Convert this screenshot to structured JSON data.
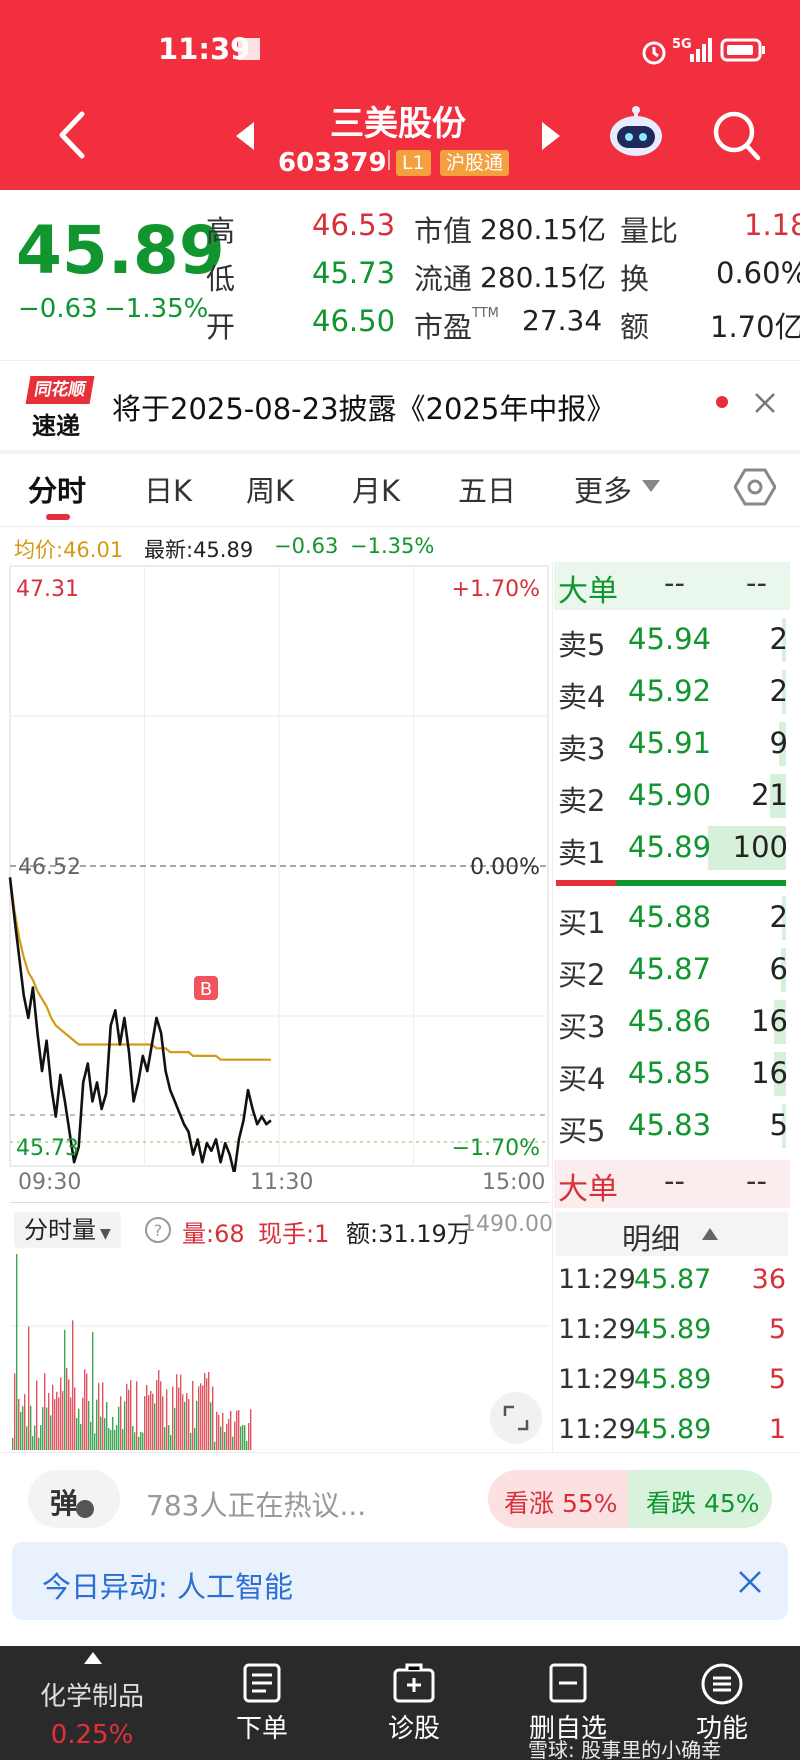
{
  "status_bar": {
    "time": "11:39",
    "network": "5G"
  },
  "header": {
    "title": "三美股份",
    "code": "603379",
    "tag_level": "L1",
    "tag_connect": "沪股通"
  },
  "quote": {
    "price": "45.89",
    "change": "−0.63",
    "change_pct": "−1.35%",
    "high_label": "高",
    "high": "46.53",
    "low_label": "低",
    "low": "45.73",
    "open_label": "开",
    "open": "46.50",
    "mcap_label": "市值",
    "mcap": "280.15亿",
    "float_label": "流通",
    "float": "280.15亿",
    "pe_label": "市盈",
    "pe_sup": "TTM",
    "pe": "27.34",
    "vr_label": "量比",
    "vr": "1.18",
    "turn_label": "换",
    "turn": "0.60%",
    "amt_label": "额",
    "amt": "1.70亿"
  },
  "notice": {
    "logo_top": "同花顺",
    "logo_bottom": "速递",
    "text": "将于2025-08-23披露《2025年中报》"
  },
  "tabs": [
    {
      "label": "分时"
    },
    {
      "label": "日K"
    },
    {
      "label": "周K"
    },
    {
      "label": "月K"
    },
    {
      "label": "五日"
    },
    {
      "label": "更多"
    }
  ],
  "chart_info": {
    "avg": "均价:46.01",
    "latest": "最新:45.89",
    "chg": "−0.63",
    "chg_pct": "−1.35%"
  },
  "chart_data": {
    "type": "line",
    "y_max_label": "47.31",
    "y_mid_label": "46.52",
    "y_min_label": "45.73",
    "pct_max_label": "+1.70%",
    "pct_mid_label": "0.00%",
    "pct_min_label": "−1.70%",
    "x_labels": [
      "09:30",
      "11:30",
      "15:00"
    ],
    "ylim": [
      45.73,
      47.31
    ],
    "prev_close": 46.52,
    "marker_label": "B",
    "price": [
      46.49,
      46.38,
      46.28,
      46.18,
      46.12,
      46.2,
      46.08,
      45.98,
      46.06,
      45.94,
      45.86,
      45.97,
      45.9,
      45.82,
      45.74,
      45.78,
      45.95,
      46.0,
      45.9,
      45.95,
      45.88,
      45.92,
      46.1,
      46.14,
      46.05,
      46.12,
      46.03,
      45.9,
      45.95,
      46.02,
      45.98,
      46.05,
      46.12,
      46.08,
      45.98,
      45.93,
      45.9,
      45.87,
      45.84,
      45.82,
      45.76,
      45.8,
      45.74,
      45.79,
      45.77,
      45.8,
      45.74,
      45.79,
      45.76,
      45.71,
      45.8,
      45.85,
      45.93,
      45.88,
      45.84,
      45.86,
      45.84,
      45.85
    ],
    "avg": [
      46.49,
      46.4,
      46.33,
      46.28,
      46.24,
      46.22,
      46.19,
      46.17,
      46.15,
      46.12,
      46.1,
      46.09,
      46.08,
      46.07,
      46.06,
      46.05,
      46.05,
      46.05,
      46.05,
      46.05,
      46.05,
      46.05,
      46.05,
      46.05,
      46.05,
      46.05,
      46.05,
      46.05,
      46.05,
      46.05,
      46.05,
      46.05,
      46.04,
      46.04,
      46.04,
      46.03,
      46.03,
      46.03,
      46.03,
      46.03,
      46.02,
      46.02,
      46.02,
      46.02,
      46.02,
      46.02,
      46.01,
      46.01,
      46.01,
      46.01,
      46.01,
      46.01,
      46.01,
      46.01,
      46.01,
      46.01,
      46.01,
      46.01
    ],
    "volume_label": "分时量",
    "vol_text": "量:68",
    "now_hand": "现手:1",
    "vol_amt": "额:31.19万",
    "vol_max_label": "1490.00"
  },
  "order_book": {
    "big_label": "大单",
    "dash": "--",
    "asks": [
      {
        "label": "卖5",
        "price": "45.94",
        "vol": "2",
        "frac": 0.02
      },
      {
        "label": "卖4",
        "price": "45.92",
        "vol": "2",
        "frac": 0.02
      },
      {
        "label": "卖3",
        "price": "45.91",
        "vol": "9",
        "frac": 0.09
      },
      {
        "label": "卖2",
        "price": "45.90",
        "vol": "21",
        "frac": 0.21
      },
      {
        "label": "卖1",
        "price": "45.89",
        "vol": "100",
        "frac": 1.0
      }
    ],
    "bids": [
      {
        "label": "买1",
        "price": "45.88",
        "vol": "2",
        "frac": 0.02
      },
      {
        "label": "买2",
        "price": "45.87",
        "vol": "6",
        "frac": 0.06
      },
      {
        "label": "买3",
        "price": "45.86",
        "vol": "16",
        "frac": 0.16
      },
      {
        "label": "买4",
        "price": "45.85",
        "vol": "16",
        "frac": 0.16
      },
      {
        "label": "买5",
        "price": "45.83",
        "vol": "5",
        "frac": 0.05
      }
    ],
    "detail_label": "明细",
    "ticks": [
      {
        "time": "11:29",
        "price": "45.87",
        "vol": "36"
      },
      {
        "time": "11:29",
        "price": "45.89",
        "vol": "5"
      },
      {
        "time": "11:29",
        "price": "45.89",
        "vol": "5"
      },
      {
        "time": "11:29",
        "price": "45.89",
        "vol": "1"
      }
    ]
  },
  "discuss": {
    "danmu": "弹",
    "text": "783人正在热议...",
    "up": "看涨 55%",
    "down": "看跌 45%"
  },
  "alert": {
    "text": "今日异动: 人工智能"
  },
  "bottom_nav": [
    {
      "label": "化学制品",
      "sub": "0.25%"
    },
    {
      "label": "下单"
    },
    {
      "label": "诊股"
    },
    {
      "label": "删自选"
    },
    {
      "label": "功能"
    }
  ],
  "watermark": "雪球: 股事里的小确幸"
}
